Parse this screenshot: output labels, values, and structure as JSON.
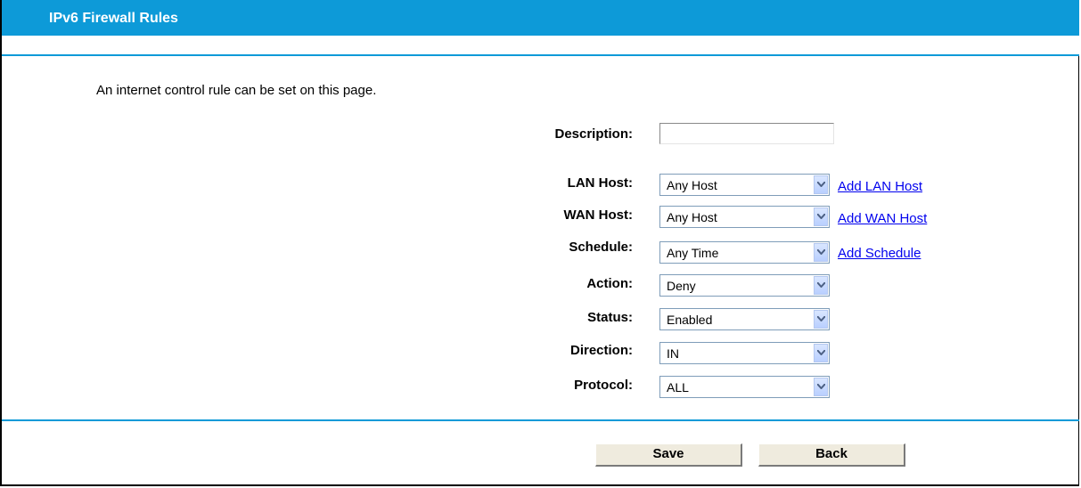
{
  "header": {
    "title": "IPv6 Firewall Rules"
  },
  "intro": "An internet control rule can be set on this page.",
  "form": {
    "description": {
      "label": "Description:",
      "value": ""
    },
    "lan_host": {
      "label": "LAN Host:",
      "value": "Any Host",
      "link": "Add LAN Host"
    },
    "wan_host": {
      "label": "WAN Host:",
      "value": "Any Host",
      "link": "Add WAN Host"
    },
    "schedule": {
      "label": "Schedule:",
      "value": "Any Time",
      "link": "Add Schedule"
    },
    "action": {
      "label": "Action:",
      "value": "Deny"
    },
    "status": {
      "label": "Status:",
      "value": "Enabled"
    },
    "direction": {
      "label": "Direction:",
      "value": "IN"
    },
    "protocol": {
      "label": "Protocol:",
      "value": "ALL"
    }
  },
  "buttons": {
    "save": "Save",
    "back": "Back"
  },
  "colors": {
    "accent": "#0d9ad8",
    "link": "#0000ee",
    "button_bg": "#efebde"
  }
}
